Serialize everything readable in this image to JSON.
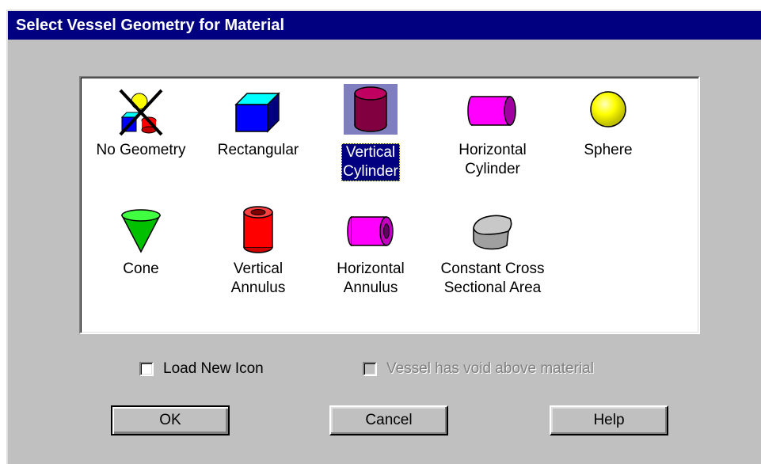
{
  "window": {
    "title": "Select Vessel Geometry for Material"
  },
  "geometries": [
    {
      "label": "No Geometry",
      "icon": "no-geometry-icon"
    },
    {
      "label": "Rectangular",
      "icon": "rectangular-box-icon"
    },
    {
      "label": "Vertical\nCylinder",
      "icon": "vertical-cylinder-icon",
      "selected": true
    },
    {
      "label": "Horizontal\nCylinder",
      "icon": "horizontal-cylinder-icon"
    },
    {
      "label": "Sphere",
      "icon": "sphere-icon"
    },
    {
      "label": "Cone",
      "icon": "cone-icon"
    },
    {
      "label": "Vertical\nAnnulus",
      "icon": "vertical-annulus-icon"
    },
    {
      "label": "Horizontal\nAnnulus",
      "icon": "horizontal-annulus-icon"
    },
    {
      "label": "Constant Cross\nSectional Area",
      "icon": "constant-cross-section-icon"
    }
  ],
  "options": {
    "load_new_icon": {
      "label": "Load New Icon",
      "checked": false,
      "enabled": true
    },
    "void_above": {
      "label": "Vessel has void above material",
      "checked": false,
      "enabled": false
    }
  },
  "buttons": {
    "ok": "OK",
    "cancel": "Cancel",
    "help": "Help"
  },
  "colors": {
    "titlebar": "#000080",
    "face": "#c0c0c0",
    "selection": "#000080",
    "blue": "#0000ff",
    "cyan": "#00ffff",
    "maroon": "#800040",
    "magenta": "#ff00ff",
    "yellow": "#ffff00",
    "red": "#ff0000",
    "green": "#00c000",
    "gray": "#a0a0a0"
  }
}
